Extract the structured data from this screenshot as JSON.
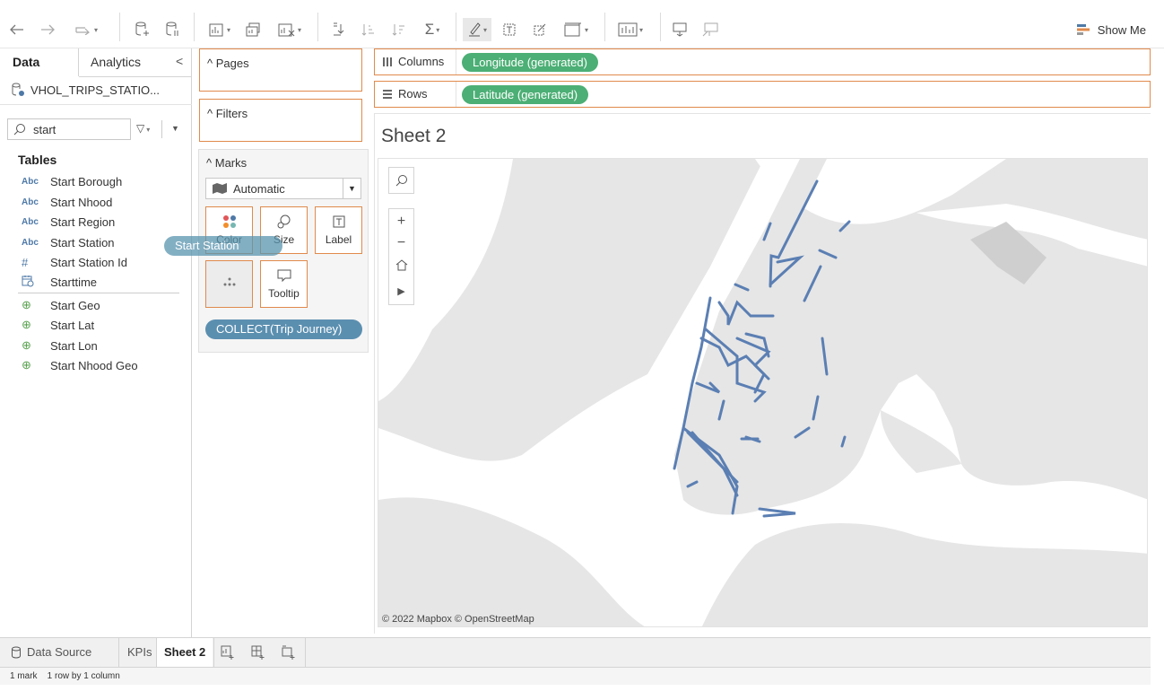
{
  "toolbar": {
    "show_me_label": "Show Me",
    "icons": [
      "back-icon",
      "forward-icon",
      "redo-icon",
      "new-data-source-icon",
      "pause-updates-icon",
      "new-worksheet-icon",
      "duplicate-sheet-icon",
      "clear-sheet-icon",
      "swap-icon",
      "sort-ascending-icon",
      "sort-descending-icon",
      "totals-icon",
      "highlight-icon",
      "labels-icon",
      "annotate-icon",
      "fit-icon",
      "chart-icon",
      "presentation-icon",
      "share-icon"
    ]
  },
  "left_pane": {
    "tabs": {
      "data": "Data",
      "analytics": "Analytics"
    },
    "data_source": "VHOL_TRIPS_STATIO...",
    "search_value": "start",
    "tables_heading": "Tables",
    "fields": [
      {
        "type": "Abc",
        "name": "Start Borough"
      },
      {
        "type": "Abc",
        "name": "Start Nhood"
      },
      {
        "type": "Abc",
        "name": "Start Region"
      },
      {
        "type": "Abc",
        "name": "Start Station"
      },
      {
        "type": "#",
        "name": "Start Station Id"
      },
      {
        "type": "date",
        "name": "Starttime"
      },
      {
        "type": "geo",
        "name": "Start Geo"
      },
      {
        "type": "geo",
        "name": "Start Lat"
      },
      {
        "type": "geo",
        "name": "Start Lon"
      },
      {
        "type": "geo",
        "name": "Start Nhood Geo"
      }
    ],
    "dragged_pill": "Start Station"
  },
  "shelves": {
    "pages": "Pages",
    "filters": "Filters",
    "marks": "Marks",
    "mark_type": "Automatic",
    "buttons": {
      "color": "Color",
      "size": "Size",
      "label": "Label",
      "detail": "",
      "tooltip": "Tooltip"
    },
    "mark_pill": "COLLECT(Trip Journey)"
  },
  "view": {
    "columns_label": "Columns",
    "rows_label": "Rows",
    "columns_pill": "Longitude (generated)",
    "rows_pill": "Latitude (generated)",
    "sheet_title": "Sheet 2",
    "attribution": "© 2022 Mapbox  © OpenStreetMap",
    "map_line_color": "#5b7fb3"
  },
  "bottom": {
    "data_source_tab": "Data Source",
    "tabs": [
      "KPIs",
      "Sheet 2"
    ],
    "active_tab": "Sheet 2",
    "status": "1 mark    1 row by 1 column"
  },
  "colors": {
    "shelf_border": "#e08a4c",
    "green_pill": "#4caf75",
    "blue_pill": "#5b8fb0"
  }
}
